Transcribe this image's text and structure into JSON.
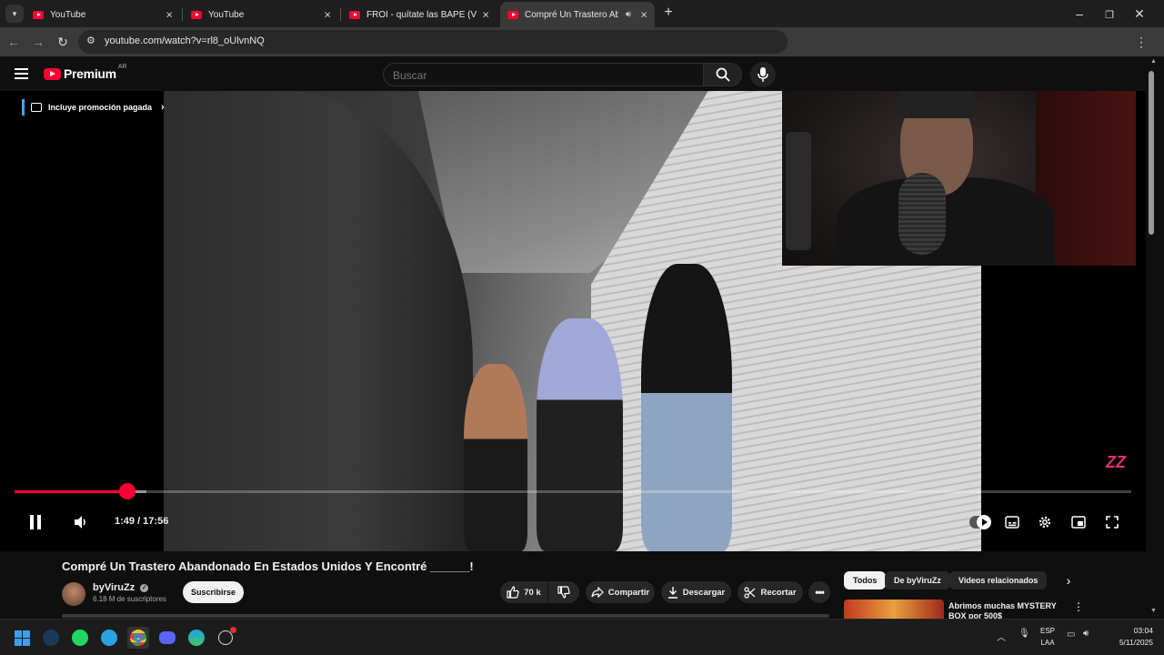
{
  "browser": {
    "tabs": [
      {
        "title": "YouTube",
        "active": false
      },
      {
        "title": "YouTube",
        "active": false
      },
      {
        "title": "FROI - quítate las BAPE (Visualiz",
        "active": false
      },
      {
        "title": "Compré Un Trastero Aband",
        "active": true
      }
    ],
    "url": "youtube.com/watch?v=rl8_oUlvnNQ",
    "close_glyph": "×",
    "new_tab_glyph": "+"
  },
  "youtube_header": {
    "logo_text": "Premium",
    "country_code": "AR",
    "search_placeholder": "Buscar"
  },
  "player": {
    "promo_label": "Incluye promoción pagada",
    "current_time": "1:49",
    "duration": "17:56",
    "time_display": "1:49 / 17:56",
    "progress_fraction": 0.1013,
    "watermark": "ZZ"
  },
  "video_info": {
    "title": "Compré Un Trastero Abandonado En Estados Unidos Y Encontré ______!",
    "channel_name": "byViruZz",
    "subscribers": "6.18 M de suscriptores",
    "subscribe_label": "Suscribirse",
    "likes": "70 k",
    "share_label": "Compartir",
    "download_label": "Descargar",
    "clip_label": "Recortar"
  },
  "sidebar": {
    "chips": [
      "Todos",
      "De byViruZz",
      "Videos relacionados"
    ],
    "recommendation_title": "Abrimos muchas MYSTERY BOX por 500$"
  },
  "taskbar": {
    "language": "ESP",
    "language_sub": "LAA",
    "time": "03:04",
    "date": "5/11/2025"
  },
  "colors": {
    "accent": "#ff0033",
    "background": "#0f0f0f",
    "chip_active": "#f1f1f1"
  }
}
